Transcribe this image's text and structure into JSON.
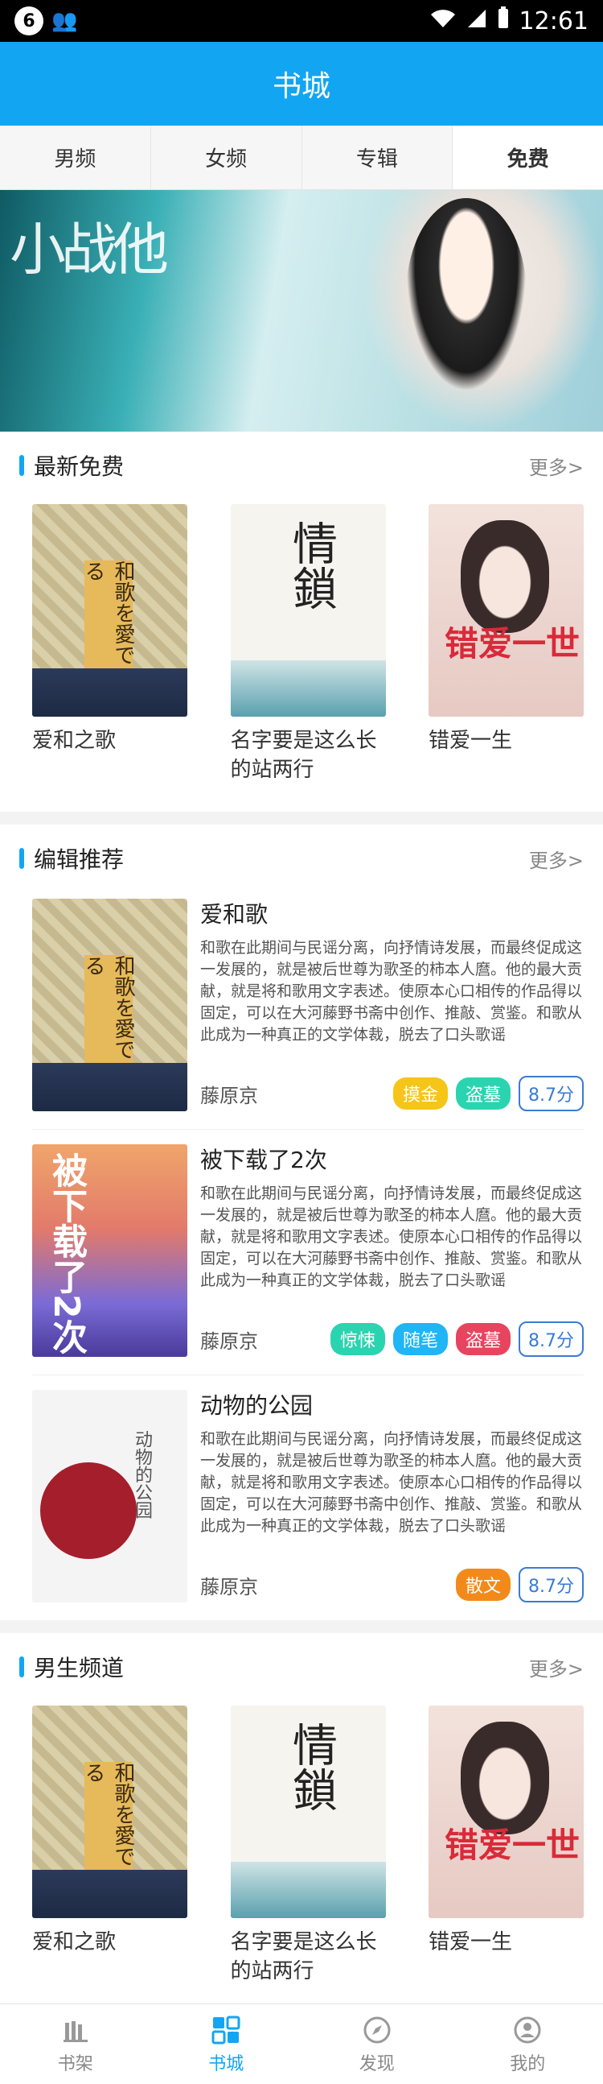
{
  "status_bar": {
    "badge": "6",
    "time": "12:61"
  },
  "header": {
    "title": "书城"
  },
  "tabs": [
    {
      "label": "男频"
    },
    {
      "label": "女频"
    },
    {
      "label": "专辑"
    },
    {
      "label": "免费"
    }
  ],
  "banner": {
    "logo_text": "小战他"
  },
  "sections": {
    "free": {
      "title": "最新免费",
      "more": "更多>",
      "books": [
        {
          "title": "爱和之歌",
          "cover_text": "和歌を愛でる"
        },
        {
          "title": "名字要是这么长的站两行",
          "cover_text": "情鎖"
        },
        {
          "title": "错爱一生",
          "cover_text": "错爱一世"
        }
      ]
    },
    "editor": {
      "title": "编辑推荐",
      "more": "更多>",
      "items": [
        {
          "title": "爱和歌",
          "desc": "和歌在此期间与民谣分离，向抒情诗发展，而最终促成这一发展的，就是被后世尊为歌圣的柿本人麿。他的最大贡献，就是将和歌用文字表述。使原本心口相传的作品得以固定，可以在大河藤野书斋中创作、推敲、赏鉴。和歌从此成为一种真正的文学体裁，脱去了口头歌谣",
          "author": "藤原京",
          "tags": [
            {
              "text": "摸金",
              "color": "#f5c518"
            },
            {
              "text": "盗墓",
              "color": "#2bd4b0"
            }
          ],
          "score": "8.7分",
          "cover_text": "和歌を愛でる"
        },
        {
          "title": "被下载了2次",
          "desc": "和歌在此期间与民谣分离，向抒情诗发展，而最终促成这一发展的，就是被后世尊为歌圣的柿本人麿。他的最大贡献，就是将和歌用文字表述。使原本心口相传的作品得以固定，可以在大河藤野书斋中创作、推敲、赏鉴。和歌从此成为一种真正的文学体裁，脱去了口头歌谣",
          "author": "藤原京",
          "tags": [
            {
              "text": "惊悚",
              "color": "#2bd4b0"
            },
            {
              "text": "随笔",
              "color": "#20b5f5"
            },
            {
              "text": "盗墓",
              "color": "#e8445f"
            }
          ],
          "score": "8.7分",
          "cover_text": "被下载了2次"
        },
        {
          "title": "动物的公园",
          "desc": "和歌在此期间与民谣分离，向抒情诗发展，而最终促成这一发展的，就是被后世尊为歌圣的柿本人麿。他的最大贡献，就是将和歌用文字表述。使原本心口相传的作品得以固定，可以在大河藤野书斋中创作、推敲、赏鉴。和歌从此成为一种真正的文学体裁，脱去了口头歌谣",
          "author": "藤原京",
          "tags": [
            {
              "text": "散文",
              "color": "#f28a1b"
            }
          ],
          "score": "8.7分",
          "cover_text": "动物的公园"
        }
      ]
    },
    "male": {
      "title": "男生频道",
      "more": "更多>",
      "books": [
        {
          "title": "爱和之歌",
          "cover_text": "和歌を愛でる"
        },
        {
          "title": "名字要是这么长的站两行",
          "cover_text": "情鎖"
        },
        {
          "title": "错爱一生",
          "cover_text": "错爱一世"
        }
      ]
    }
  },
  "bottom_nav": [
    {
      "label": "书架",
      "icon": "bookshelf-icon"
    },
    {
      "label": "书城",
      "icon": "grid-icon"
    },
    {
      "label": "发现",
      "icon": "compass-icon"
    },
    {
      "label": "我的",
      "icon": "profile-icon"
    }
  ],
  "colors": {
    "accent": "#12a6f2",
    "score": "#3a7bd5"
  }
}
